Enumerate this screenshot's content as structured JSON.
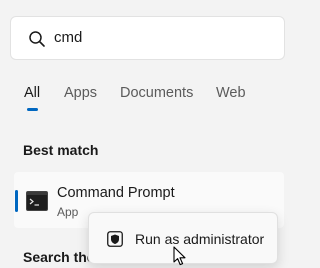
{
  "search": {
    "icon": "search-icon",
    "query": "cmd"
  },
  "tabs": [
    {
      "label": "All",
      "active": true
    },
    {
      "label": "Apps",
      "active": false
    },
    {
      "label": "Documents",
      "active": false
    },
    {
      "label": "Web",
      "active": false
    }
  ],
  "best_match": {
    "title": "Best match",
    "result": {
      "name": "Command Prompt",
      "type": "App",
      "icon": "command-prompt-icon"
    }
  },
  "context_menu": {
    "items": [
      {
        "label": "Run as administrator",
        "icon": "shield-icon"
      }
    ]
  },
  "search_the_web": {
    "title": "Search the"
  },
  "colors": {
    "accent": "#0067c0",
    "background": "#f3f3f3"
  }
}
